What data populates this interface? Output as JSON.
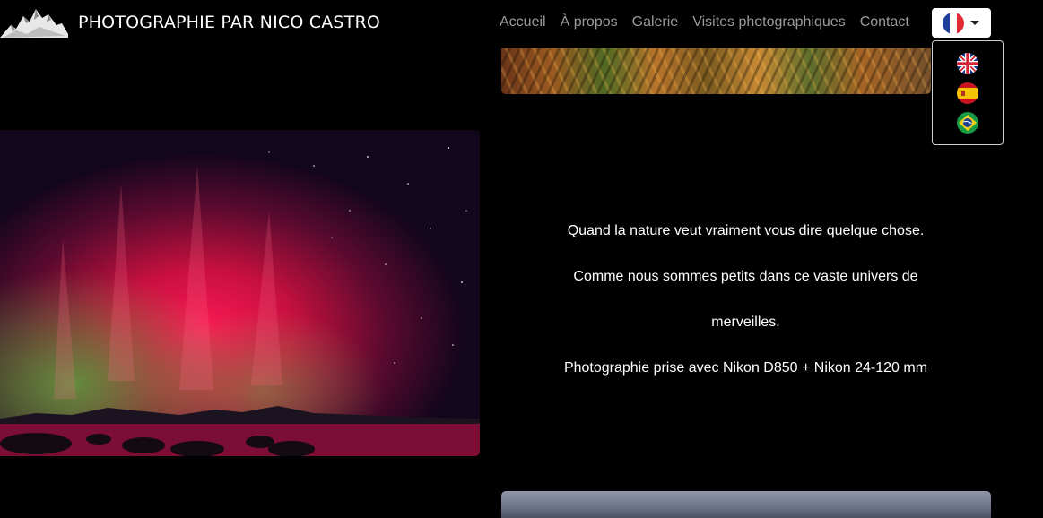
{
  "brand": {
    "title": "PHOTOGRAPHIE PAR NICO CASTRO",
    "logo_icon": "mountain-logo"
  },
  "nav": {
    "items": [
      {
        "label": "Accueil"
      },
      {
        "label": "À propos"
      },
      {
        "label": "Galerie"
      },
      {
        "label": "Visites photographiques"
      },
      {
        "label": "Contact"
      }
    ],
    "color": "#9b9b9b"
  },
  "language": {
    "selected_flag": "france-flag-icon",
    "toggle_icon": "caret-down-icon",
    "options": [
      {
        "flag": "uk-flag-icon"
      },
      {
        "flag": "spain-flag-icon"
      },
      {
        "flag": "brazil-flag-icon"
      }
    ]
  },
  "caption": {
    "lines": [
      "Quand la nature veut vraiment vous dire quelque chose.",
      "Comme nous sommes petits dans ce vaste univers de",
      "merveilles.",
      "Photographie prise avec Nikon D850 + Nikon 24-120 mm"
    ]
  },
  "colors": {
    "background": "#000000",
    "text": "#ffffff",
    "aurora_red": "#e0124a",
    "aurora_green": "#4f8a3a"
  }
}
